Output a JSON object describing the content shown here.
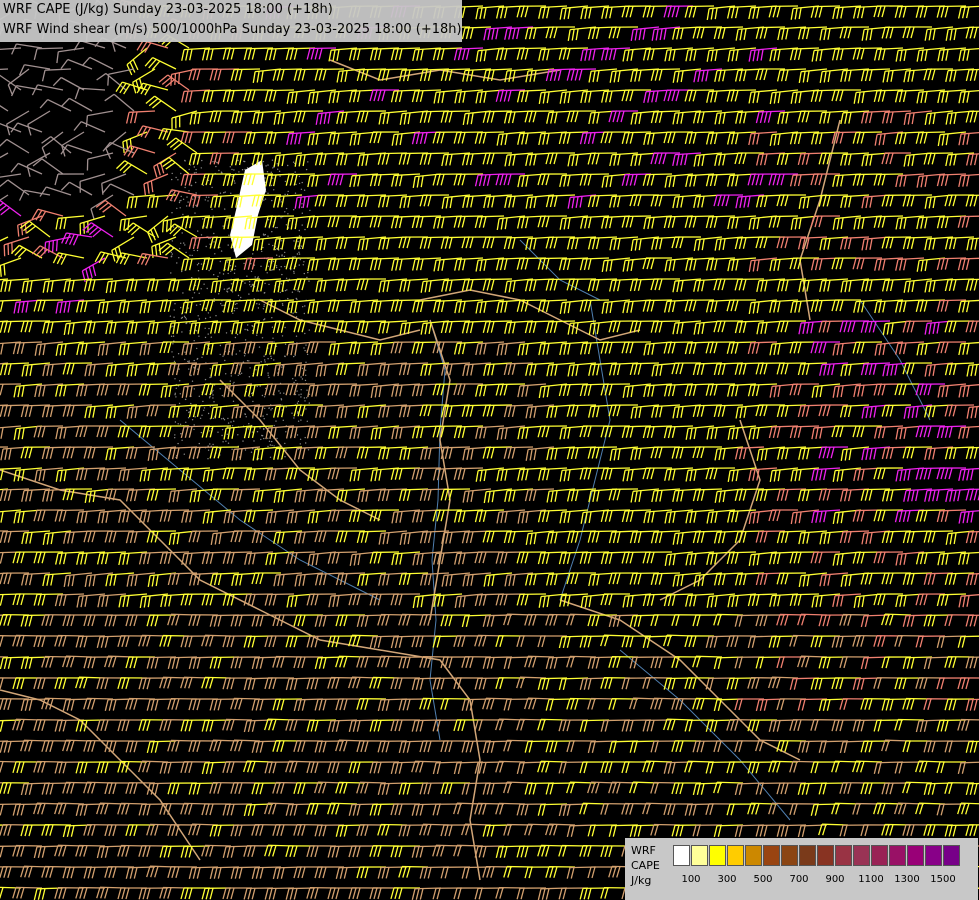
{
  "title": {
    "line1": "WRF CAPE (J/kg) Sunday 23-03-2025 18:00 (+18h)",
    "line2": "WRF Wind shear (m/s) 500/1000hPa Sunday 23-03-2025 18:00 (+18h)"
  },
  "legend": {
    "label_model": "WRF",
    "label_field": "CAPE",
    "label_unit": "J/kg",
    "colors": [
      "#ffffff",
      "#ffff99",
      "#ffff00",
      "#ffcc00",
      "#cc8800",
      "#994411",
      "#8b4513",
      "#7a3a1a",
      "#883322",
      "#993344",
      "#993355",
      "#992255",
      "#991166",
      "#990077",
      "#880088",
      "#770088"
    ],
    "tick_labels": [
      "100",
      "300",
      "500",
      "700",
      "900",
      "1100",
      "1300",
      "1500"
    ]
  },
  "palette": {
    "barb_yellow": "#ffff33",
    "barb_tan": "#d2a06e",
    "barb_salmon": "#f08070",
    "barb_magenta": "#ee22ee",
    "barb_grey": "#a09090",
    "border_tan": "#d2a678",
    "river_blue": "#4f7fb0"
  }
}
